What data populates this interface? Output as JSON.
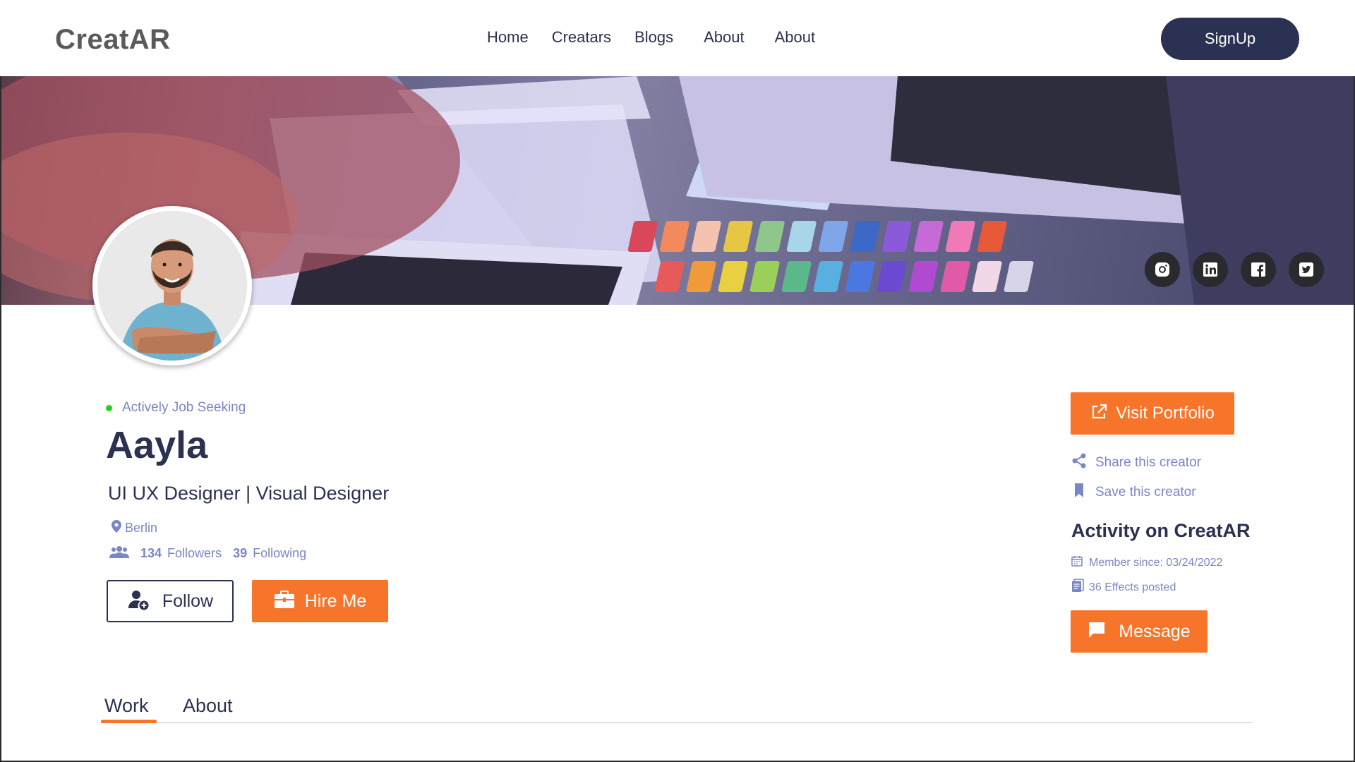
{
  "header": {
    "logo_text": "CreatAR",
    "nav": [
      "Home",
      "Creatars",
      "Blogs",
      "About",
      "About"
    ],
    "signup_label": "SignUp"
  },
  "banner": {
    "social_icons": [
      "instagram-icon",
      "linkedin-icon",
      "facebook-icon",
      "twitter-icon"
    ]
  },
  "profile": {
    "status": "Actively Job Seeking",
    "name": "Aayla",
    "role": "UI UX Designer | Visual Designer",
    "location": "Berlin",
    "followers_count": "134",
    "followers_label": "Followers",
    "following_count": "39",
    "following_label": "Following",
    "follow_label": "Follow",
    "hire_label": "Hire Me"
  },
  "sidebar": {
    "visit_label": "Visit Portfolio",
    "share_label": "Share this creator",
    "save_label": "Save this creator",
    "activity_title": "Activity on CreatAR",
    "member_since": "Member since: 03/24/2022",
    "effects_posted": "36 Effects posted",
    "message_label": "Message"
  },
  "tabs": [
    "Work",
    "About"
  ],
  "colors": {
    "accent": "#f7752a",
    "navy": "#2a3152",
    "muted": "#7b86c4",
    "status_green": "#1fd11f"
  }
}
